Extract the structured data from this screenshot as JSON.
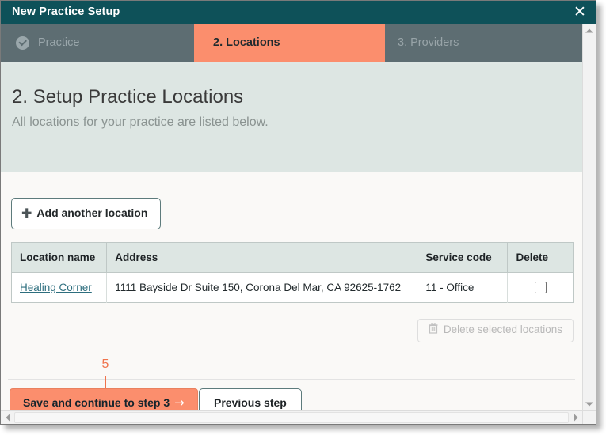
{
  "window": {
    "title": "New Practice Setup",
    "close_icon": "close-icon",
    "close_glyph": "✕"
  },
  "tabs": [
    {
      "label": "Practice",
      "state": "completed",
      "icon": "check-circle-icon"
    },
    {
      "label": "2. Locations",
      "state": "active"
    },
    {
      "label": "3. Providers",
      "state": "upcoming"
    }
  ],
  "header": {
    "title": "2. Setup Practice Locations",
    "subtitle": "All locations for your practice are listed below."
  },
  "toolbar": {
    "add_label": "Add another location",
    "add_icon": "plus-icon",
    "add_glyph": "✚"
  },
  "table": {
    "columns": [
      "Location name",
      "Address",
      "Service code",
      "Delete"
    ],
    "rows": [
      {
        "name": "Healing Corner",
        "address": "1111 Bayside Dr Suite 150, Corona Del Mar, CA 92625-1762",
        "service_code": "11 - Office",
        "delete_checked": false
      }
    ]
  },
  "actions": {
    "delete_selected_label": "Delete selected locations",
    "delete_icon": "trash-icon",
    "delete_enabled": false,
    "save_label": "Save and continue to step 3",
    "save_arrow": "→",
    "previous_label": "Previous step"
  },
  "annotation": {
    "number": "5"
  },
  "scrollbars": {
    "vertical_up": "▲",
    "vertical_down": "▼",
    "horizontal_left": "◀",
    "horizontal_right": "▶"
  },
  "colors": {
    "titlebar": "#0e5159",
    "tab_inactive": "#5d6d72",
    "tab_active": "#fb8e6d",
    "header_band": "#dde6e3",
    "accent": "#fb8e6d",
    "link": "#2d6e7e",
    "annotation": "#f0734c"
  }
}
